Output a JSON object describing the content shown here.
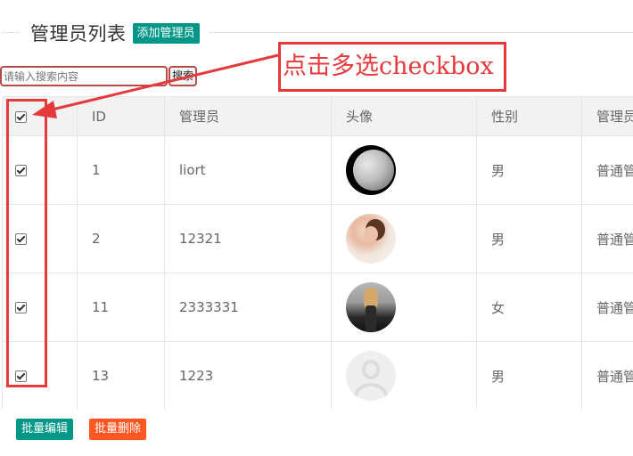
{
  "header": {
    "title": "管理员列表",
    "add_button": "添加管理员"
  },
  "search": {
    "placeholder": "请输入搜索内容",
    "button": "搜索"
  },
  "annotation": {
    "text": "点击多选checkbox",
    "color": "#e5393c"
  },
  "table": {
    "columns": [
      "",
      "ID",
      "管理员",
      "头像",
      "性别",
      "管理员"
    ],
    "rows": [
      {
        "checked": true,
        "id": "1",
        "name": "liort",
        "avatar": "moon-avatar",
        "gender": "男",
        "role": "普通管"
      },
      {
        "checked": true,
        "id": "2",
        "name": "12321",
        "avatar": "woman-avatar",
        "gender": "男",
        "role": "普通管"
      },
      {
        "checked": true,
        "id": "11",
        "name": "2333331",
        "avatar": "woman-avatar",
        "gender": "女",
        "role": "普通管"
      },
      {
        "checked": true,
        "id": "13",
        "name": "1223",
        "avatar": "default-avatar",
        "gender": "男",
        "role": "普通管"
      }
    ]
  },
  "footer": {
    "batch_edit": "批量编辑",
    "batch_delete": "批量删除"
  },
  "colors": {
    "primary": "#009688",
    "danger": "#ff5722",
    "header_bg": "#f2f2f2"
  }
}
